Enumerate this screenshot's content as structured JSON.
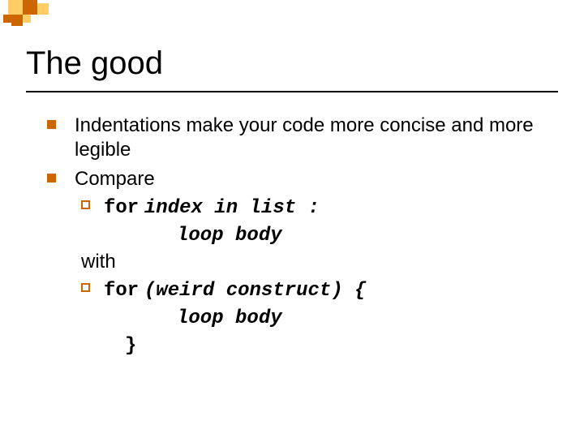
{
  "title": "The good",
  "bullets": {
    "b1": "Indentations make your code more concise and more legible",
    "b2": "Compare",
    "with": "with"
  },
  "code": {
    "ex1": {
      "kw": "for",
      "rest": "index in list :",
      "body": "loop body"
    },
    "ex2": {
      "kw": "for",
      "rest": "(weird construct) {",
      "body": "loop body",
      "close": "}"
    }
  }
}
